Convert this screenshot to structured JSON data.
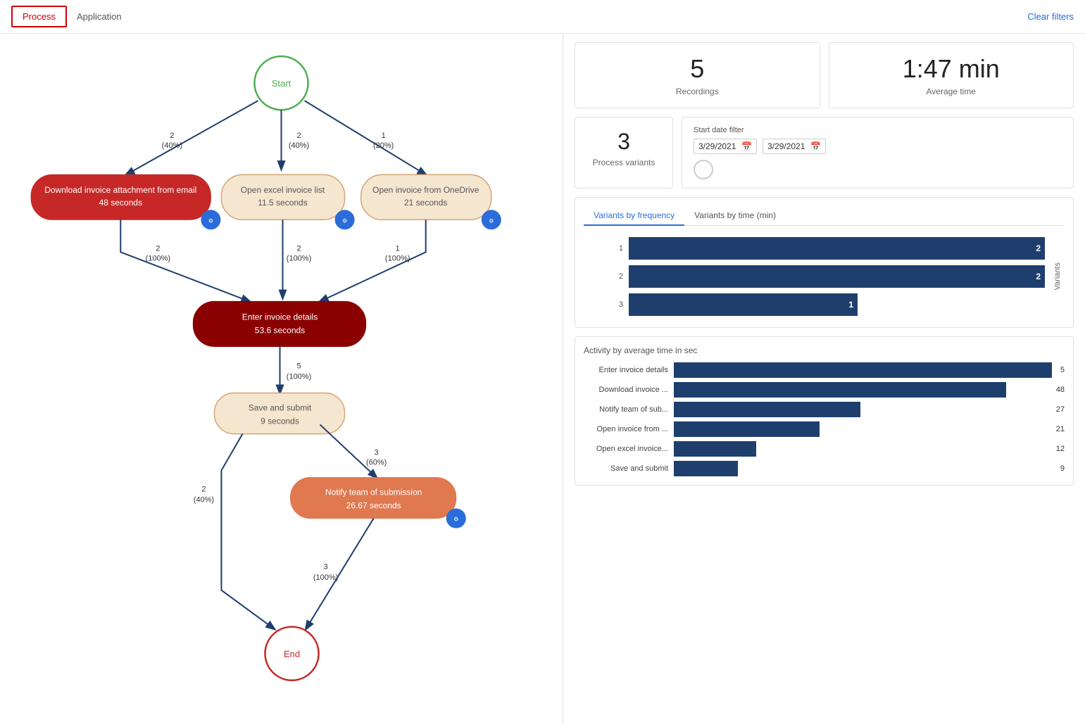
{
  "header": {
    "process_tab": "Process",
    "application_tab": "Application",
    "clear_filters": "Clear filters"
  },
  "stats": {
    "recordings_value": "5",
    "recordings_label": "Recordings",
    "avg_time_value": "1:47 min",
    "avg_time_label": "Average time",
    "variants_value": "3",
    "variants_label": "Process variants"
  },
  "date_filter": {
    "label": "Start date filter",
    "from": "3/29/2021",
    "to": "3/29/2021"
  },
  "chart_tabs": {
    "freq_label": "Variants by frequency",
    "time_label": "Variants by time (min)"
  },
  "variants_chart": {
    "y_label": "Variants",
    "bars": [
      {
        "variant": "1",
        "value": 2,
        "max": 2
      },
      {
        "variant": "2",
        "value": 2,
        "max": 2
      },
      {
        "variant": "3",
        "value": 1,
        "max": 2
      }
    ]
  },
  "activity_chart": {
    "title": "Activity by average time in sec",
    "bars": [
      {
        "label": "Enter invoice details",
        "value": 54,
        "display": "5",
        "width_pct": 100
      },
      {
        "label": "Download invoice ...",
        "value": 48,
        "display": "48",
        "width_pct": 89
      },
      {
        "label": "Notify team of sub...",
        "value": 27,
        "display": "27",
        "width_pct": 50
      },
      {
        "label": "Open invoice from ...",
        "value": 21,
        "display": "21",
        "width_pct": 39
      },
      {
        "label": "Open excel invoice...",
        "value": 12,
        "display": "12",
        "width_pct": 22
      },
      {
        "label": "Save and submit",
        "value": 9,
        "display": "9",
        "width_pct": 17
      }
    ]
  },
  "flow": {
    "start_label": "Start",
    "end_label": "End",
    "nodes": [
      {
        "id": "download",
        "label": "Download invoice attachment from email",
        "sublabel": "48 seconds",
        "type": "red"
      },
      {
        "id": "excel",
        "label": "Open excel invoice list",
        "sublabel": "11.5 seconds",
        "type": "beige"
      },
      {
        "id": "onedrive",
        "label": "Open invoice from OneDrive",
        "sublabel": "21 seconds",
        "type": "beige"
      },
      {
        "id": "enter",
        "label": "Enter invoice details",
        "sublabel": "53.6 seconds",
        "type": "dark-red"
      },
      {
        "id": "save",
        "label": "Save and submit",
        "sublabel": "9 seconds",
        "type": "beige"
      },
      {
        "id": "notify",
        "label": "Notify team of submission",
        "sublabel": "26.67 seconds",
        "type": "salmon"
      }
    ],
    "edges": [
      {
        "from": "start",
        "to": "download",
        "count": "2",
        "pct": "(40%)"
      },
      {
        "from": "start",
        "to": "excel",
        "count": "2",
        "pct": "(40%)"
      },
      {
        "from": "start",
        "to": "onedrive",
        "count": "1",
        "pct": "(20%)"
      },
      {
        "from": "download",
        "to": "enter",
        "count": "2",
        "pct": "(100%)"
      },
      {
        "from": "excel",
        "to": "enter",
        "count": "2",
        "pct": "(100%)"
      },
      {
        "from": "onedrive",
        "to": "enter",
        "count": "1",
        "pct": "(100%)"
      },
      {
        "from": "enter",
        "to": "save",
        "count": "5",
        "pct": "(100%)"
      },
      {
        "from": "save",
        "to": "notify",
        "count": "3",
        "pct": "(60%)"
      },
      {
        "from": "save",
        "to": "end",
        "count": "2",
        "pct": "(40%)"
      },
      {
        "from": "notify",
        "to": "end",
        "count": "3",
        "pct": "(100%)"
      }
    ]
  }
}
